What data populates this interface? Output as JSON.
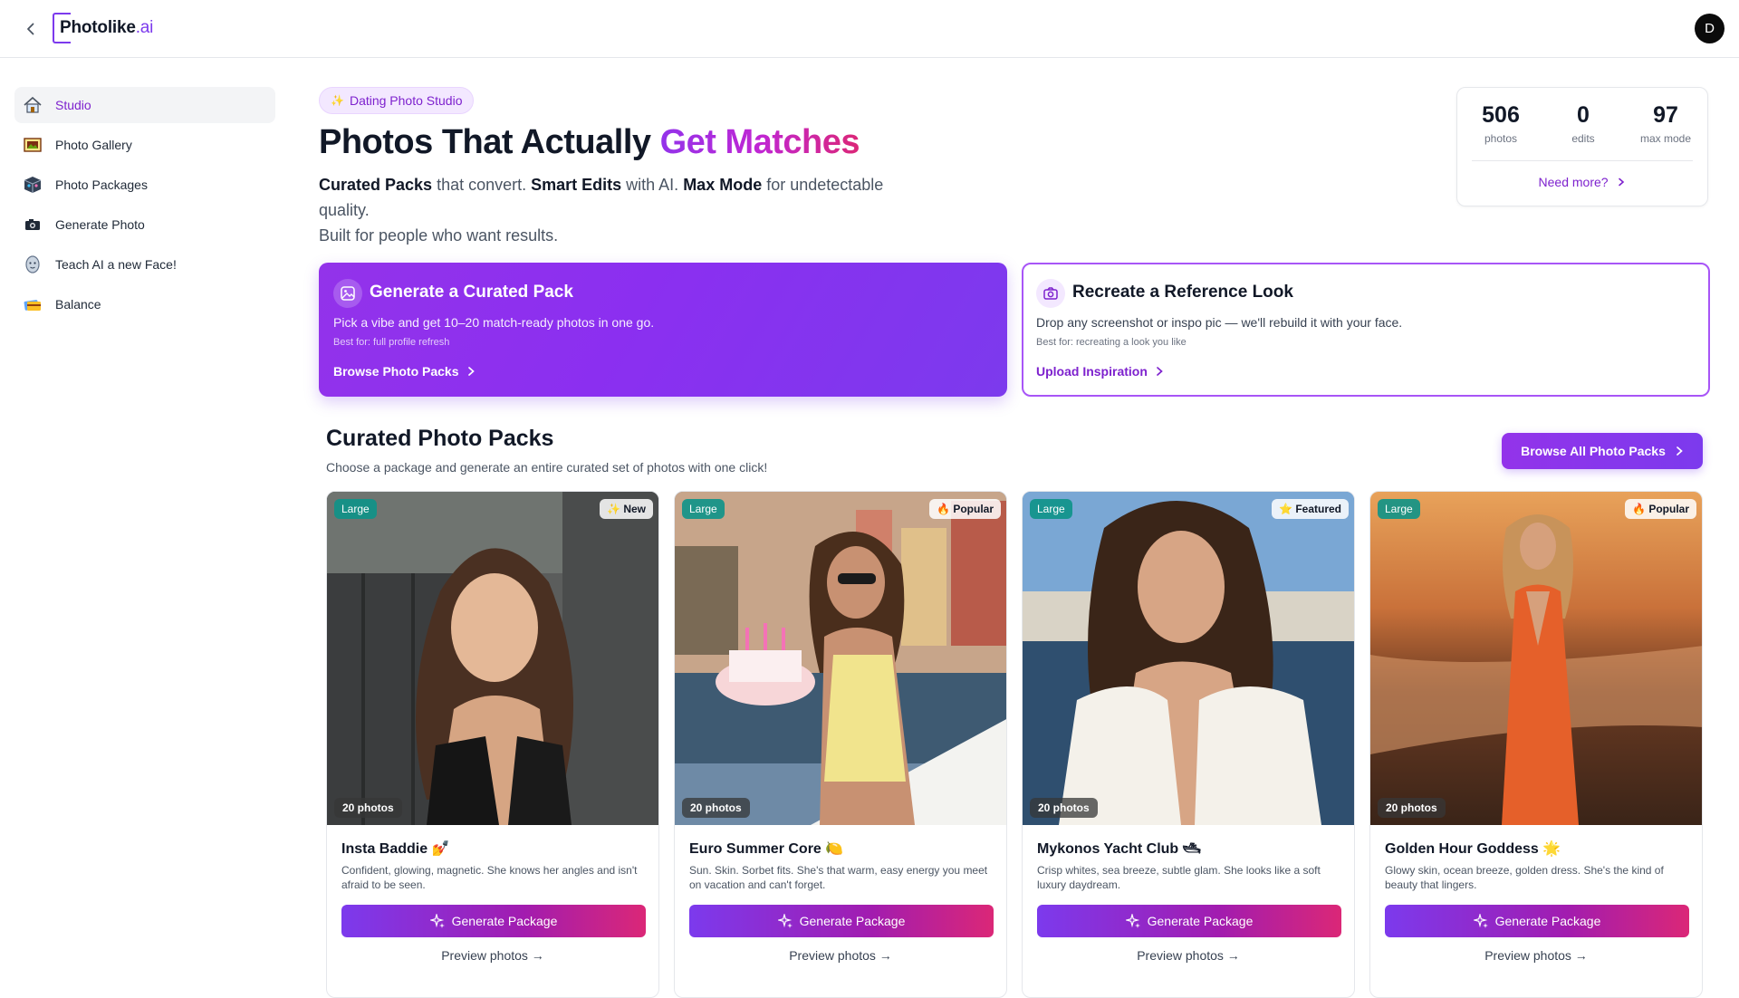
{
  "header": {
    "logo_main": "Photolike",
    "logo_suffix": ".ai",
    "avatar_initial": "D"
  },
  "sidebar": {
    "items": [
      {
        "label": "Studio",
        "icon": "house-icon"
      },
      {
        "label": "Photo Gallery",
        "icon": "gallery-icon"
      },
      {
        "label": "Photo Packages",
        "icon": "package-icon"
      },
      {
        "label": "Generate Photo",
        "icon": "camera-icon"
      },
      {
        "label": "Teach AI a new Face!",
        "icon": "face-icon"
      },
      {
        "label": "Balance",
        "icon": "wallet-icon"
      }
    ]
  },
  "hero": {
    "badge": "Dating Photo Studio",
    "title_plain": "Photos That Actually ",
    "title_accent": "Get Matches",
    "sub_b1": "Curated Packs",
    "sub_t1": " that convert. ",
    "sub_b2": "Smart Edits",
    "sub_t2": " with AI. ",
    "sub_b3": "Max Mode",
    "sub_t3": " for undetectable quality.",
    "sub_line2": "Built for people who want results."
  },
  "stats": {
    "photos_value": "506",
    "photos_label": "photos",
    "edits_value": "0",
    "edits_label": "edits",
    "max_value": "97",
    "max_label": "max mode",
    "need_more": "Need more?"
  },
  "cards": {
    "generate": {
      "title": "Generate a Curated Pack",
      "desc": "Pick a vibe and get 10–20 match-ready photos in one go.",
      "best": "Best for: full profile refresh",
      "link": "Browse Photo Packs"
    },
    "reference": {
      "title": "Recreate a Reference Look",
      "desc": "Drop any screenshot or inspo pic — we'll rebuild it with your face.",
      "best": "Best for: recreating a look you like",
      "link": "Upload Inspiration"
    }
  },
  "section": {
    "title": "Curated Photo Packs",
    "subtitle": "Choose a package and generate an entire curated set of photos with one click!",
    "browse_all": "Browse All Photo Packs"
  },
  "packs": [
    {
      "name": "Insta Baddie 💅",
      "desc": "Confident, glowing, magnetic. She knows her angles and isn't afraid to be seen.",
      "size": "Large",
      "status": "✨ New",
      "count": "20 photos",
      "button": "Generate Package",
      "preview": "Preview photos →"
    },
    {
      "name": "Euro Summer Core 🍋",
      "desc": "Sun. Skin. Sorbet fits. She's that warm, easy energy you meet on vacation and can't forget.",
      "size": "Large",
      "status": "🔥 Popular",
      "count": "20 photos",
      "button": "Generate Package",
      "preview": "Preview photos →"
    },
    {
      "name": "Mykonos Yacht Club 🛥",
      "desc": "Crisp whites, sea breeze, subtle glam. She looks like a soft luxury daydream.",
      "size": "Large",
      "status": "⭐ Featured",
      "count": "20 photos",
      "button": "Generate Package",
      "preview": "Preview photos →"
    },
    {
      "name": "Golden Hour Goddess 🌟",
      "desc": "Glowy skin, ocean breeze, golden dress. She's the kind of beauty that lingers.",
      "size": "Large",
      "status": "🔥 Popular",
      "count": "20 photos",
      "button": "Generate Package",
      "preview": "Preview photos →"
    }
  ],
  "colors": {
    "accent": "#7c3aed",
    "accent_text": "#7e22ce",
    "size_tag": "#0d9488"
  }
}
